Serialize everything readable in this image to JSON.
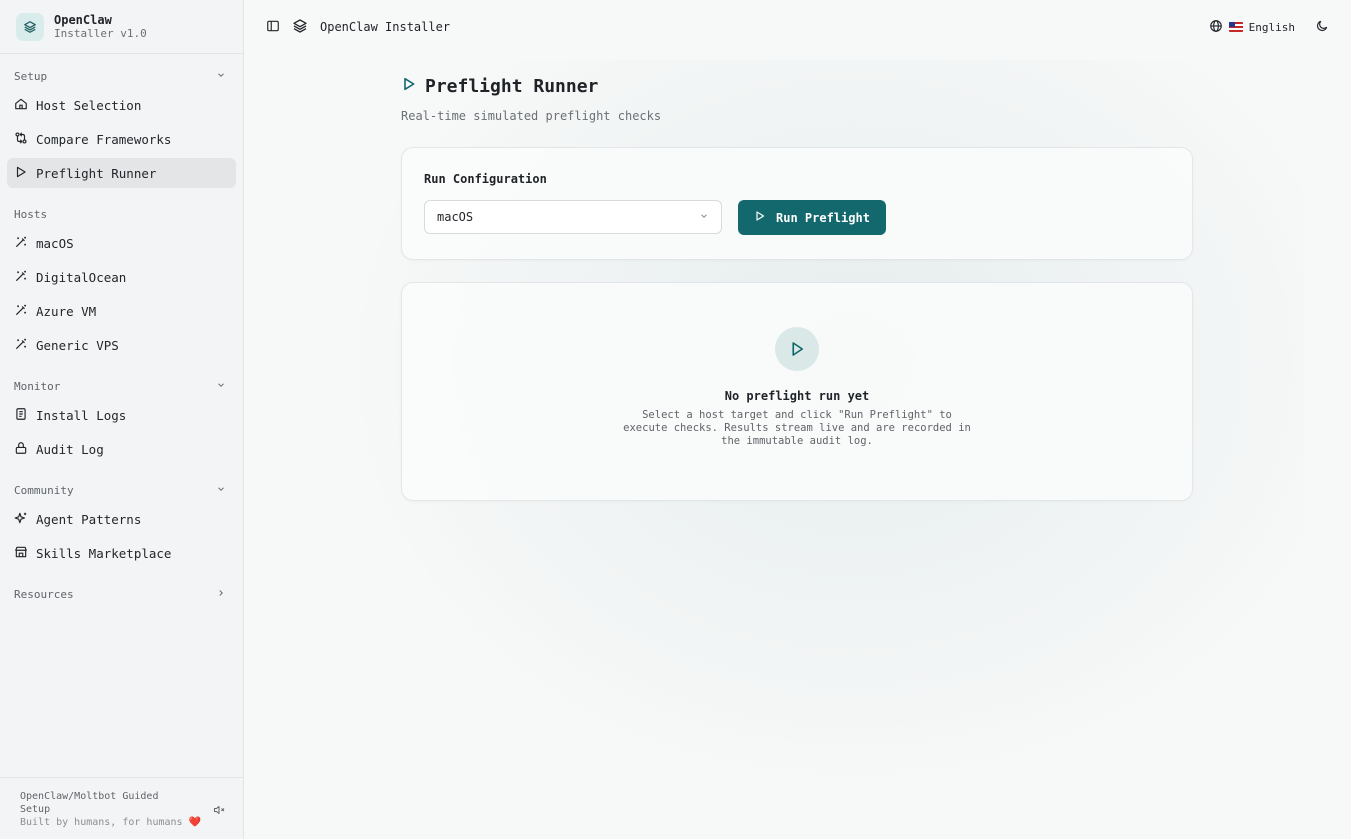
{
  "brand": {
    "name": "OpenClaw",
    "version": "Installer v1.0"
  },
  "sidebar": {
    "groups": [
      {
        "label": "Setup",
        "items": [
          {
            "label": "Host Selection",
            "icon": "home-icon"
          },
          {
            "label": "Compare Frameworks",
            "icon": "compare-icon"
          },
          {
            "label": "Preflight Runner",
            "icon": "play-icon",
            "active": true
          }
        ]
      },
      {
        "label": "Hosts",
        "items": [
          {
            "label": "macOS",
            "icon": "wand-icon"
          },
          {
            "label": "DigitalOcean",
            "icon": "wand-icon"
          },
          {
            "label": "Azure VM",
            "icon": "wand-icon"
          },
          {
            "label": "Generic VPS",
            "icon": "wand-icon"
          }
        ]
      },
      {
        "label": "Monitor",
        "items": [
          {
            "label": "Install Logs",
            "icon": "scroll-icon"
          },
          {
            "label": "Audit Log",
            "icon": "lock-icon"
          }
        ]
      },
      {
        "label": "Community",
        "items": [
          {
            "label": "Agent Patterns",
            "icon": "sparkles-icon"
          },
          {
            "label": "Skills Marketplace",
            "icon": "store-icon"
          }
        ]
      },
      {
        "label": "Resources",
        "items": []
      }
    ],
    "footer": {
      "line1": "OpenClaw/Moltbot Guided",
      "line2": "Setup",
      "credit": "Built by humans, for humans",
      "heart": "❤️"
    }
  },
  "topbar": {
    "title": "OpenClaw Installer",
    "language": "English"
  },
  "page": {
    "title": "Preflight Runner",
    "subtitle": "Real-time simulated preflight checks"
  },
  "config": {
    "label": "Run Configuration",
    "selected_host": "macOS",
    "run_button": "Run Preflight"
  },
  "empty_state": {
    "title": "No preflight run yet",
    "description": "Select a host target and click \"Run Preflight\" to execute checks. Results stream live and are recorded in the immutable audit log."
  },
  "colors": {
    "accent": "#12686c",
    "accent_soft": "#dbe8e8"
  }
}
